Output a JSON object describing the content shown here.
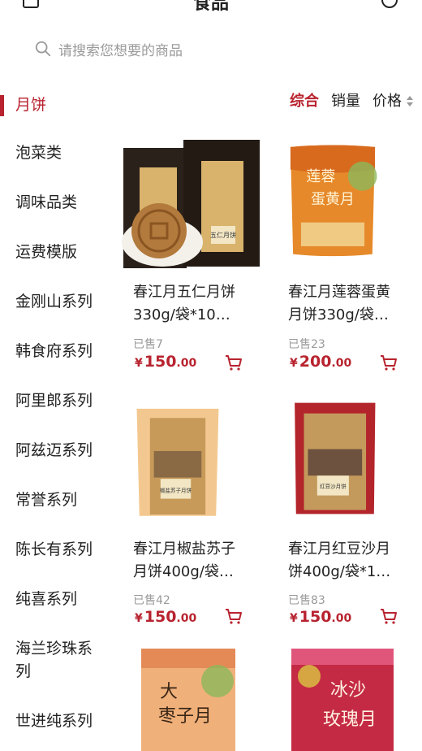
{
  "header": {
    "title": "食品",
    "back_icon": "square-icon",
    "more_icon": "circle-icon"
  },
  "search": {
    "placeholder": "请搜索您想要的商品",
    "icon": "search-icon"
  },
  "sidebar": {
    "items": [
      {
        "label": "月饼",
        "active": true
      },
      {
        "label": "泡菜类"
      },
      {
        "label": "调味品类"
      },
      {
        "label": "运费模版"
      },
      {
        "label": "金刚山系列"
      },
      {
        "label": "韩食府系列"
      },
      {
        "label": "阿里郎系列"
      },
      {
        "label": "阿兹迈系列"
      },
      {
        "label": "常誉系列"
      },
      {
        "label": "陈长有系列"
      },
      {
        "label": "纯喜系列"
      },
      {
        "label": "海兰珍珠系列"
      },
      {
        "label": "世进纯系列"
      }
    ]
  },
  "sort": {
    "comprehensive": "综合",
    "sales": "销量",
    "price": "价格"
  },
  "products": [
    {
      "name": "春江月五仁月饼330g/袋*10…",
      "sold": "已售7",
      "price_int": "150",
      "price_dec": ".00",
      "currency": "¥",
      "pack_label": "五仁月饼",
      "brand": "春江月"
    },
    {
      "name": "春江月莲蓉蛋黄月饼330g/袋…",
      "sold": "已售23",
      "price_int": "200",
      "price_dec": ".00",
      "currency": "¥",
      "pack_label": "莲蓉蛋黄月饼",
      "brand": "春江月"
    },
    {
      "name": "春江月椒盐苏子月饼400g/袋…",
      "sold": "已售42",
      "price_int": "150",
      "price_dec": ".00",
      "currency": "¥",
      "pack_label": "椒盐苏子月饼",
      "brand": "春江月"
    },
    {
      "name": "春江月红豆沙月饼400g/袋*1…",
      "sold": "已售83",
      "price_int": "150",
      "price_dec": ".00",
      "currency": "¥",
      "pack_label": "红豆沙月饼",
      "brand": "春江月"
    },
    {
      "name": "",
      "sold": "",
      "price_int": "",
      "price_dec": "",
      "currency": "",
      "pack_label": "大枣子月",
      "brand": "春江月"
    },
    {
      "name": "",
      "sold": "",
      "price_int": "",
      "price_dec": "",
      "currency": "",
      "pack_label": "冰沙玫瑰月",
      "brand": "春江月"
    }
  ],
  "colors": {
    "accent": "#b8232f",
    "muted": "#9a9a9a",
    "text": "#222222"
  }
}
